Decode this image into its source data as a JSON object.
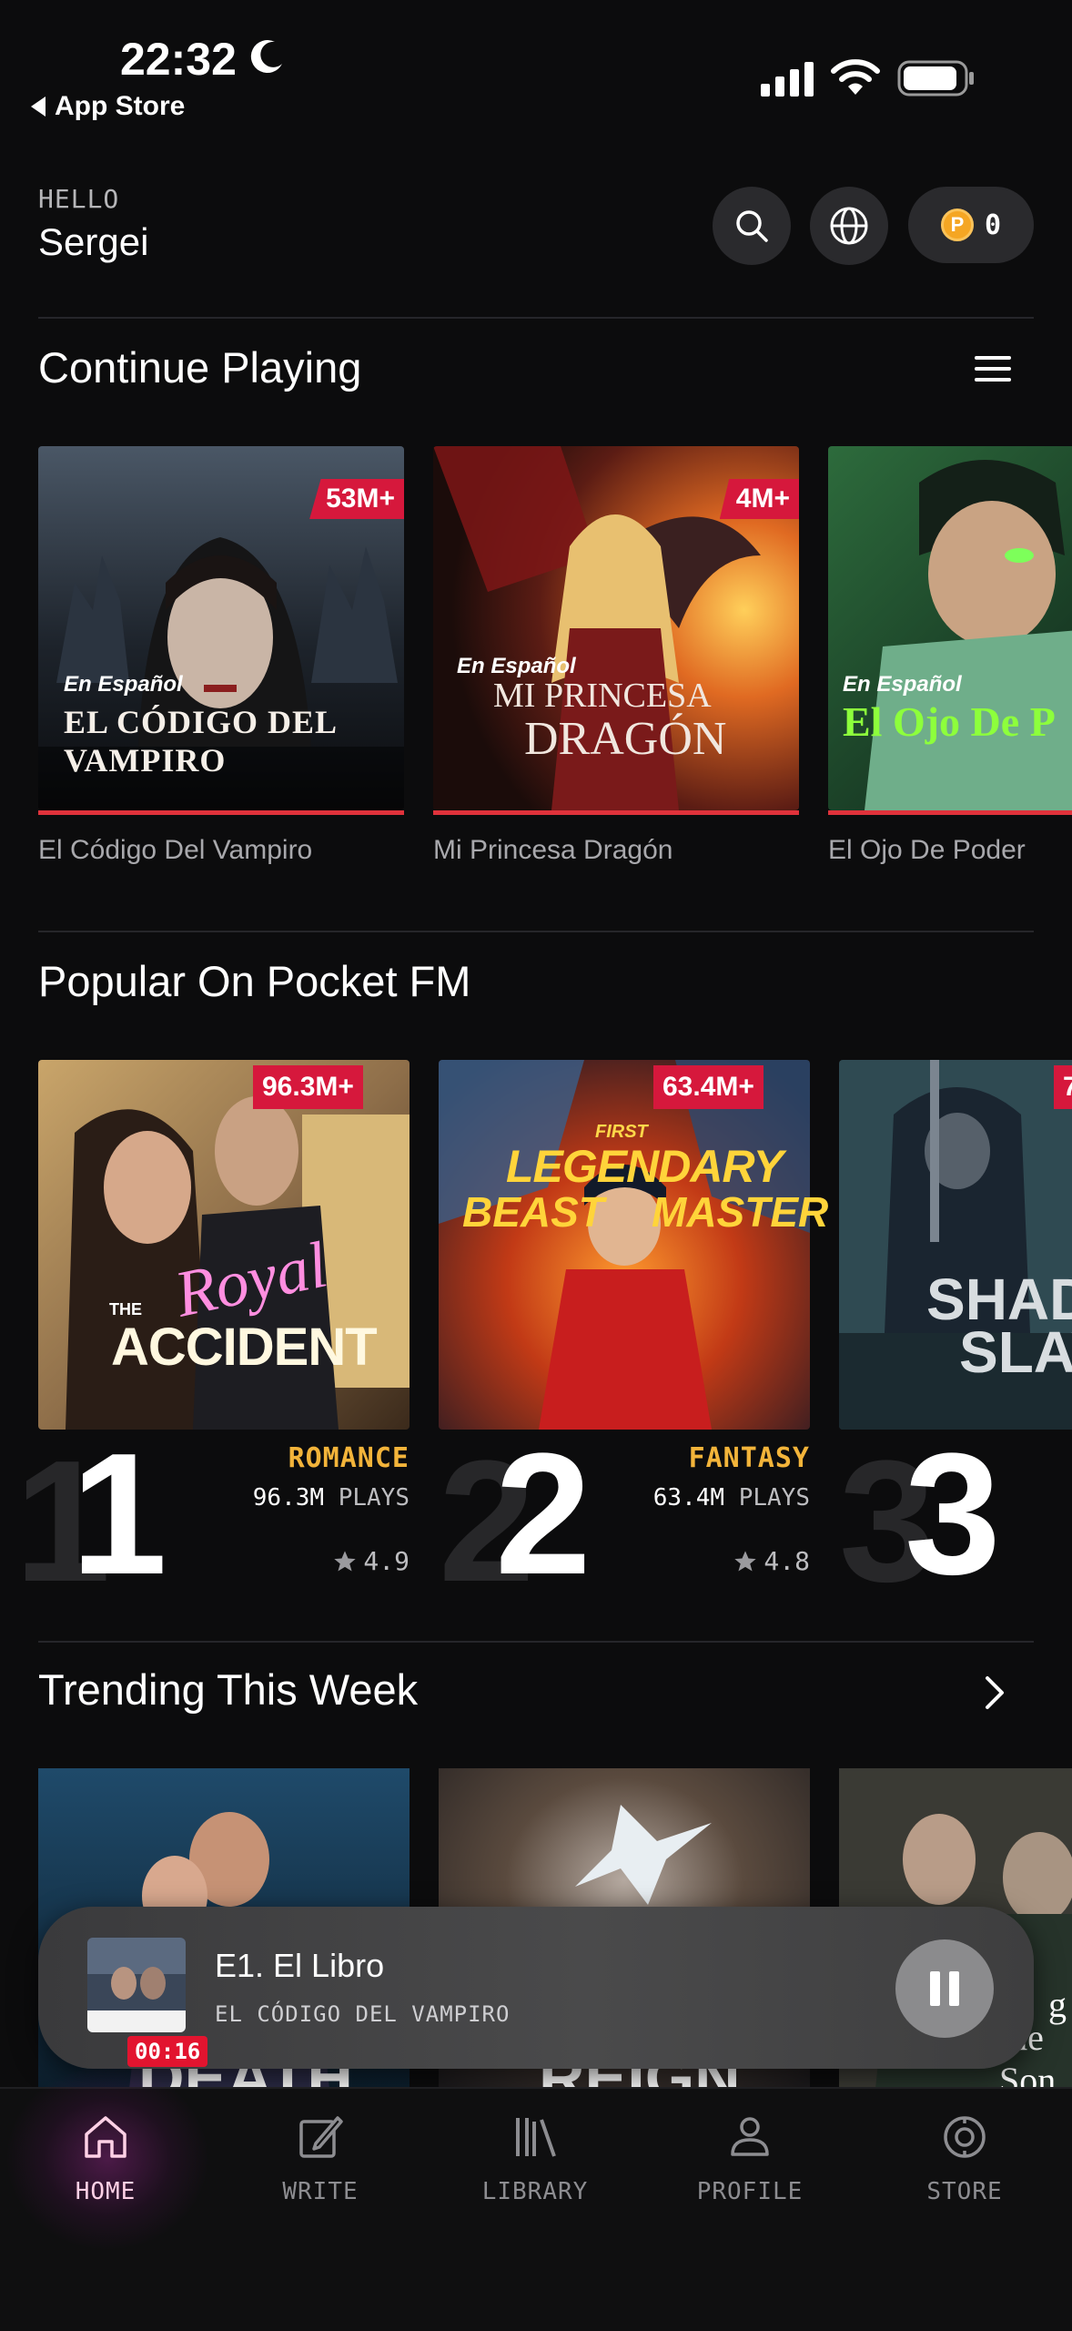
{
  "status_bar": {
    "time": "22:32",
    "back_label": "App Store"
  },
  "header": {
    "greeting": "HELLO",
    "username": "Sergei",
    "coins": "0"
  },
  "continue_playing": {
    "title": "Continue Playing",
    "items": [
      {
        "title": "El Código Del Vampiro",
        "badge": "53M+",
        "cover_text_top": "En Español",
        "cover_text": "EL CÓDIGO DEL VAMPIRO",
        "progress": 1.0
      },
      {
        "title": "Mi Princesa Dragón",
        "badge": "4M+",
        "cover_text_top": "En Español",
        "cover_text": "MI PRINCESA",
        "cover_text_2": "DRAGÓN",
        "progress": 1.0
      },
      {
        "title": "El Ojo De Poder",
        "cover_text_top": "En Español",
        "cover_text": "El Ojo De P",
        "progress": 1.0
      }
    ]
  },
  "popular": {
    "title": "Popular On Pocket FM",
    "items": [
      {
        "rank": "1",
        "badge": "96.3M+",
        "cover_text_small": "THE",
        "cover_text_script": "Royal",
        "cover_text": "ACCIDENT",
        "genre": "ROMANCE",
        "plays_num": "96.3M",
        "plays_label": "PLAYS",
        "rating": "4.9"
      },
      {
        "rank": "2",
        "badge": "63.4M+",
        "cover_text_small": "FIRST",
        "cover_text": "LEGENDARY",
        "cover_text_2": "BEAST",
        "cover_text_3": "MASTER",
        "genre": "FANTASY",
        "plays_num": "63.4M",
        "plays_label": "PLAYS",
        "rating": "4.8"
      },
      {
        "rank": "3",
        "badge": "7",
        "cover_text": "SHADO",
        "cover_text_2": "SLAV"
      }
    ]
  },
  "trending": {
    "title": "Trending This Week",
    "items": [
      {
        "cover_text": "DEATH"
      },
      {
        "cover_text": "REIGN"
      },
      {
        "cover_text": "g",
        "cover_text_2": "the Son"
      }
    ]
  },
  "player": {
    "episode": "E1. El Libro",
    "show": "EL CÓDIGO DEL VAMPIRO",
    "elapsed": "00:16"
  },
  "nav": {
    "items": [
      {
        "label": "HOME",
        "icon": "home-icon"
      },
      {
        "label": "WRITE",
        "icon": "pencil-icon"
      },
      {
        "label": "LIBRARY",
        "icon": "books-icon"
      },
      {
        "label": "PROFILE",
        "icon": "person-icon"
      },
      {
        "label": "STORE",
        "icon": "store-icon"
      }
    ]
  },
  "colors": {
    "accent_red": "#d6183c",
    "genre_gold": "#f3b43a",
    "background": "#0c0c0d",
    "active_nav": "#ffd1e6"
  }
}
